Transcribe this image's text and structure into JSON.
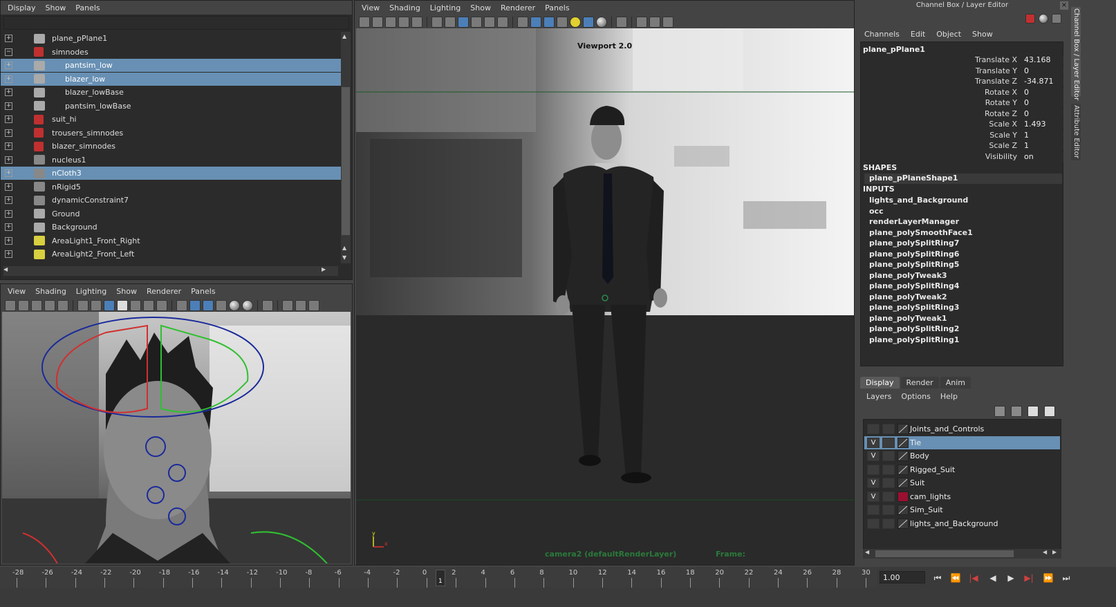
{
  "outliner": {
    "menu": [
      "Display",
      "Show",
      "Panels"
    ],
    "items": [
      {
        "label": "plane_pPlane1",
        "indent": 0,
        "icon": "transform-icon",
        "selected": false
      },
      {
        "label": "simnodes",
        "indent": 0,
        "icon": "group-icon",
        "selected": false
      },
      {
        "label": "pantsim_low",
        "indent": 1,
        "icon": "transform-icon",
        "selected": true
      },
      {
        "label": "blazer_low",
        "indent": 1,
        "icon": "transform-icon",
        "selected": true
      },
      {
        "label": "blazer_lowBase",
        "indent": 1,
        "icon": "transform-icon",
        "selected": false
      },
      {
        "label": "pantsim_lowBase",
        "indent": 1,
        "icon": "transform-icon",
        "selected": false
      },
      {
        "label": "suit_hi",
        "indent": 0,
        "icon": "group-icon",
        "selected": false
      },
      {
        "label": "trousers_simnodes",
        "indent": 0,
        "icon": "group-icon",
        "selected": false
      },
      {
        "label": "blazer_simnodes",
        "indent": 0,
        "icon": "group-icon",
        "selected": false
      },
      {
        "label": "nucleus1",
        "indent": 0,
        "icon": "nucleus-icon",
        "selected": false
      },
      {
        "label": "nCloth3",
        "indent": 0,
        "icon": "ncloth-icon",
        "selected": true
      },
      {
        "label": "nRigid5",
        "indent": 0,
        "icon": "nrigid-icon",
        "selected": false
      },
      {
        "label": "dynamicConstraint7",
        "indent": 0,
        "icon": "constraint-icon",
        "selected": false
      },
      {
        "label": "Ground",
        "indent": 0,
        "icon": "transform-icon",
        "selected": false
      },
      {
        "label": "Background",
        "indent": 0,
        "icon": "transform-icon",
        "selected": false
      },
      {
        "label": "AreaLight1_Front_Right",
        "indent": 0,
        "icon": "light-icon",
        "selected": false
      },
      {
        "label": "AreaLight2_Front_Left",
        "indent": 0,
        "icon": "light-icon",
        "selected": false
      }
    ]
  },
  "viewport_left": {
    "menu": [
      "View",
      "Shading",
      "Lighting",
      "Show",
      "Renderer",
      "Panels"
    ]
  },
  "viewport_main": {
    "menu": [
      "View",
      "Shading",
      "Lighting",
      "Show",
      "Renderer",
      "Panels"
    ],
    "label": "Viewport 2.0",
    "hud_camera": "camera2 (defaultRenderLayer)",
    "hud_frame": "Frame:"
  },
  "channel_box": {
    "title": "Channel Box / Layer Editor",
    "menu": [
      "Channels",
      "Edit",
      "Object",
      "Show"
    ],
    "object_name": "plane_pPlane1",
    "attributes": [
      {
        "label": "Translate X",
        "value": "43.168"
      },
      {
        "label": "Translate Y",
        "value": "0"
      },
      {
        "label": "Translate Z",
        "value": "-34.871"
      },
      {
        "label": "Rotate X",
        "value": "0"
      },
      {
        "label": "Rotate Y",
        "value": "0"
      },
      {
        "label": "Rotate Z",
        "value": "0"
      },
      {
        "label": "Scale X",
        "value": "1.493"
      },
      {
        "label": "Scale Y",
        "value": "1"
      },
      {
        "label": "Scale Z",
        "value": "1"
      },
      {
        "label": "Visibility",
        "value": "on"
      }
    ],
    "shapes_header": "SHAPES",
    "shape": "plane_pPlaneShape1",
    "inputs_header": "INPUTS",
    "inputs": [
      "lights_and_Background",
      "occ",
      "renderLayerManager",
      "plane_polySmoothFace1",
      "plane_polySplitRing7",
      "plane_polySplitRing6",
      "plane_polySplitRing5",
      "plane_polyTweak3",
      "plane_polySplitRing4",
      "plane_polyTweak2",
      "plane_polySplitRing3",
      "plane_polyTweak1",
      "plane_polySplitRing2",
      "plane_polySplitRing1"
    ]
  },
  "layer_editor": {
    "tabs": [
      "Display",
      "Render",
      "Anim"
    ],
    "menu": [
      "Layers",
      "Options",
      "Help"
    ],
    "layers": [
      {
        "name": "Joints_and_Controls",
        "visible": "",
        "color": "",
        "selected": false
      },
      {
        "name": "Tie",
        "visible": "V",
        "color": "",
        "selected": true
      },
      {
        "name": "Body",
        "visible": "V",
        "color": "",
        "selected": false
      },
      {
        "name": "Rigged_Suit",
        "visible": "",
        "color": "",
        "selected": false
      },
      {
        "name": "Suit",
        "visible": "V",
        "color": "",
        "selected": false
      },
      {
        "name": "cam_lights",
        "visible": "V",
        "color": "#9a1030",
        "selected": false
      },
      {
        "name": "Sim_Suit",
        "visible": "",
        "color": "",
        "selected": false
      },
      {
        "name": "lights_and_Background",
        "visible": "",
        "color": "",
        "selected": false
      }
    ]
  },
  "side_tabs": [
    "Channel Box / Layer Editor",
    "Attribute Editor"
  ],
  "timeline": {
    "ticks": [
      "-28",
      "-26",
      "-24",
      "-22",
      "-20",
      "-18",
      "-16",
      "-14",
      "-12",
      "-10",
      "-8",
      "-6",
      "-4",
      "-2",
      "0",
      "2",
      "4",
      "6",
      "8",
      "10",
      "12",
      "14",
      "16",
      "18",
      "20",
      "22",
      "24",
      "26",
      "28",
      "30"
    ],
    "current_frame": "1",
    "frame_field": "1.00"
  },
  "colors": {
    "accent": "#6890b4",
    "background": "#444444",
    "panel": "#2b2b2b"
  }
}
